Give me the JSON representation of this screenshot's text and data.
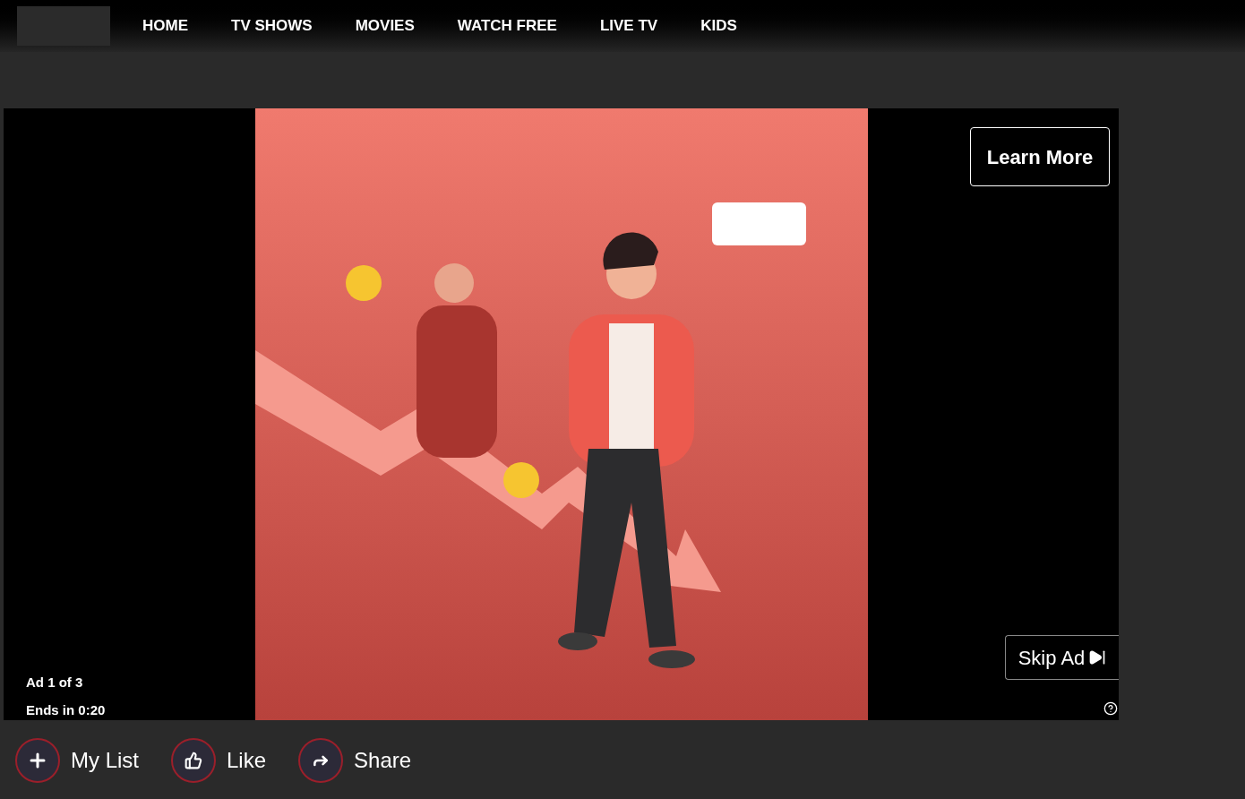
{
  "nav": {
    "items": [
      {
        "label": "HOME"
      },
      {
        "label": "TV SHOWS"
      },
      {
        "label": "MOVIES"
      },
      {
        "label": "WATCH FREE"
      },
      {
        "label": "LIVE TV"
      },
      {
        "label": "KIDS"
      }
    ]
  },
  "player": {
    "learn_more": "Learn More",
    "skip": "Skip Ad",
    "ad_position": "Ad 1 of 3",
    "ends_in": "Ends in 0:20"
  },
  "actions": [
    {
      "kind": "add",
      "label": "My List"
    },
    {
      "kind": "like",
      "label": "Like"
    },
    {
      "kind": "share",
      "label": "Share"
    }
  ]
}
